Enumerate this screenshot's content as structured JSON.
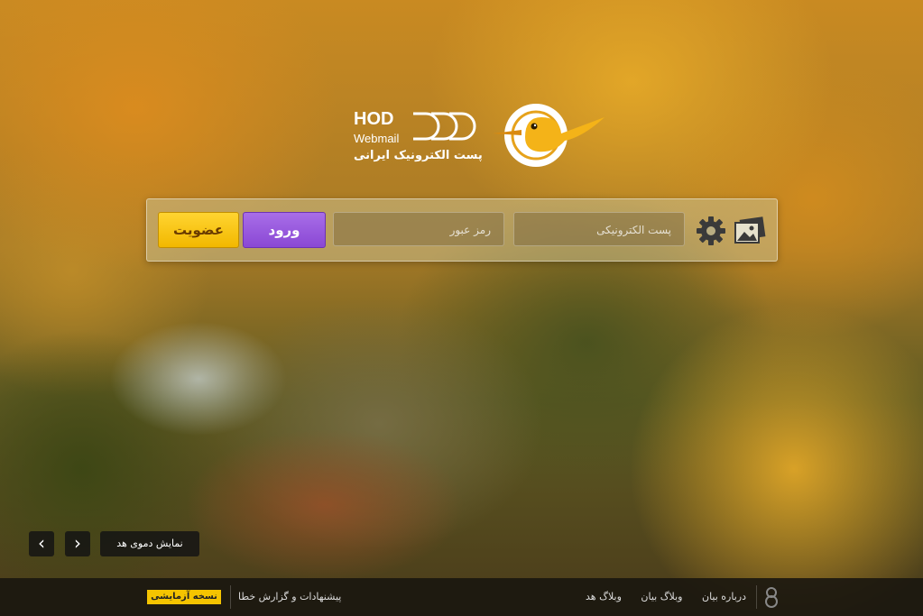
{
  "logo": {
    "brand": "HOD",
    "product": "Webmail",
    "tagline": "پست الکترونیک ایرانی"
  },
  "login": {
    "email_placeholder": "پست الکترونیکی",
    "password_placeholder": "رمز عبور",
    "login_label": "ورود",
    "register_label": "عضویت"
  },
  "slideshow": {
    "prev_icon": "chevron-left-icon",
    "next_icon": "chevron-right-icon",
    "demo_label": "نمایش دموی هد"
  },
  "footer": {
    "beta_badge": "نسخه آزمایشی",
    "report_link": "پیشنهادات و گزارش خطا",
    "links": [
      "درباره بیان",
      "وبلاگ بیان",
      "وبلاگ هد"
    ]
  },
  "colors": {
    "login_button": "#9a5ae0",
    "register_button": "#f5c400",
    "beta_badge": "#f5c400"
  }
}
